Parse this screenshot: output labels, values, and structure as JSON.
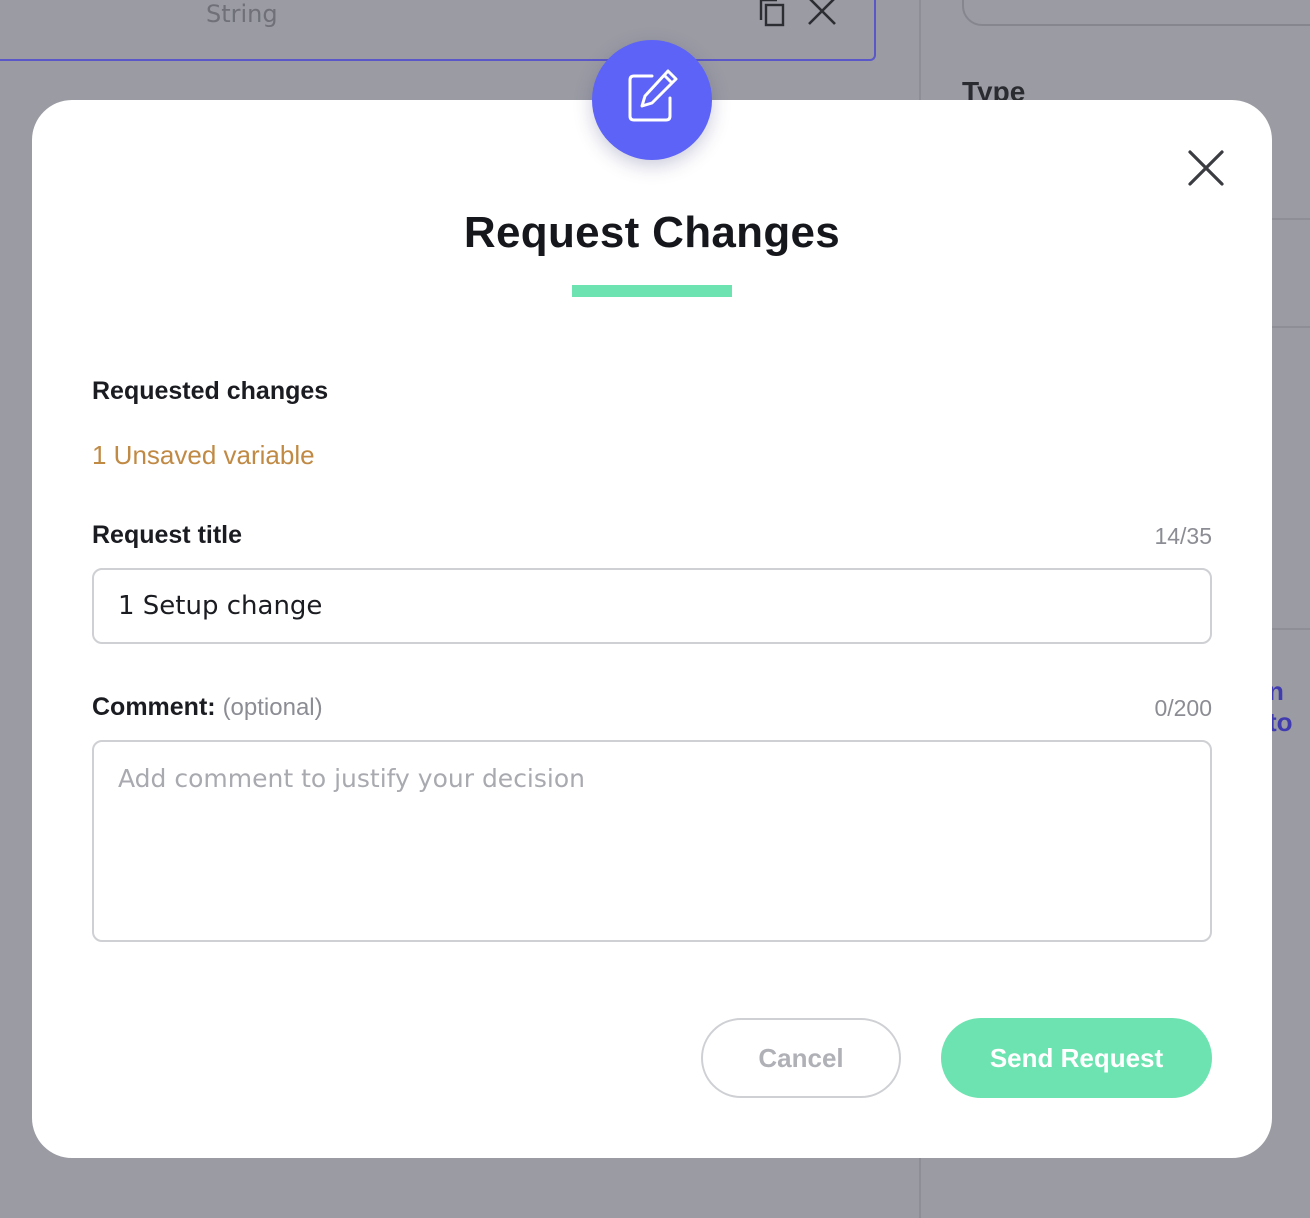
{
  "background": {
    "field_type": "String",
    "right_panel_label": "Type",
    "right_panel_link": "n to"
  },
  "modal": {
    "title": "Request Changes",
    "requested_changes_label": "Requested changes",
    "unsaved_text": "1 Unsaved variable",
    "request_title_label": "Request title",
    "request_title_counter": "14/35",
    "request_title_value": "1 Setup change",
    "comment_label": "Comment:",
    "comment_optional": "(optional)",
    "comment_counter": "0/200",
    "comment_placeholder": "Add comment to justify your decision",
    "comment_value": "",
    "cancel_label": "Cancel",
    "send_label": "Send Request"
  },
  "colors": {
    "accent_purple": "#5d63f6",
    "accent_green": "#6ce3b0",
    "warning_orange": "#c08a45"
  },
  "icons": {
    "badge": "edit-icon",
    "close": "close-icon",
    "bg_copy": "copy-icon",
    "bg_close": "close-icon"
  }
}
